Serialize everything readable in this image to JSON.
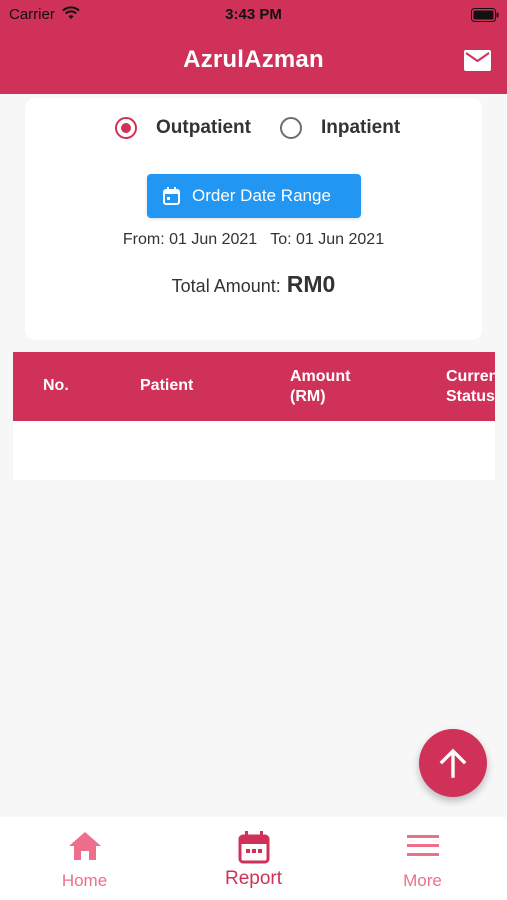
{
  "status_bar": {
    "carrier": "Carrier",
    "time": "3:43 PM"
  },
  "app_bar": {
    "title": "AzrulAzman",
    "mail_icon": "mail-icon"
  },
  "filter": {
    "patient_types": [
      {
        "label": "Outpatient",
        "selected": true
      },
      {
        "label": "Inpatient",
        "selected": false
      }
    ],
    "date_range_button": "Order Date Range",
    "date_range_text": "From: 01 Jun 2021   To: 01 Jun 2021",
    "total_label": "Total Amount:",
    "total_value": "RM0"
  },
  "table": {
    "columns": [
      "No.",
      "Patient",
      "Amount\n(RM)",
      "Current\nStatus"
    ],
    "rows": []
  },
  "fab": {
    "icon": "arrow-up-icon"
  },
  "bottom_nav": {
    "items": [
      {
        "label": "Home",
        "icon": "home-icon"
      },
      {
        "label": "Report",
        "icon": "calendar-icon",
        "active": true
      },
      {
        "label": "More",
        "icon": "menu-icon"
      }
    ]
  },
  "colors": {
    "primary": "#cf3158",
    "primary_light": "#ee6f8b",
    "accent_button": "#2196f3",
    "background": "#f7f7f7"
  }
}
